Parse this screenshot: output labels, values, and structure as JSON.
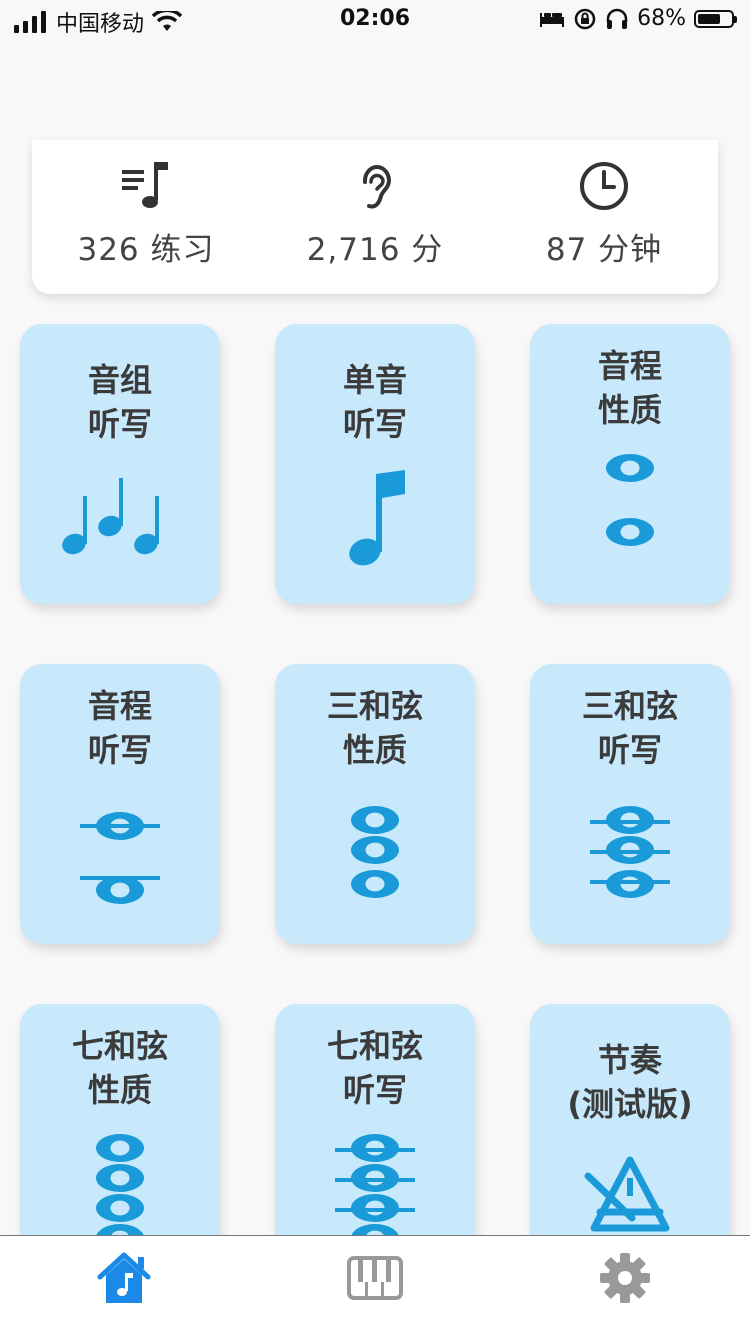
{
  "status_bar": {
    "carrier": "中国移动",
    "time": "02:06",
    "battery_percent": "68%",
    "battery_level": 0.68,
    "icons": [
      "signal-icon",
      "wifi-icon",
      "bed-icon",
      "orientation-lock-icon",
      "headphones-icon",
      "battery-icon"
    ]
  },
  "stats": [
    {
      "icon": "music-list-icon",
      "text": "326  练习"
    },
    {
      "icon": "ear-icon",
      "text": "2,716  分"
    },
    {
      "icon": "clock-icon",
      "text": "87  分钟"
    }
  ],
  "tiles": [
    {
      "title": "音组\n听写",
      "icon": "note-group-icon"
    },
    {
      "title": "单音\n听写",
      "icon": "single-note-icon"
    },
    {
      "title": "音程\n性质",
      "icon": "interval-quality-icon"
    },
    {
      "title": "音程\n听写",
      "icon": "interval-dictation-icon"
    },
    {
      "title": "三和弦\n性质",
      "icon": "triad-quality-icon"
    },
    {
      "title": "三和弦\n听写",
      "icon": "triad-dictation-icon"
    },
    {
      "title": "七和弦\n性质",
      "icon": "seventh-quality-icon"
    },
    {
      "title": "七和弦\n听写",
      "icon": "seventh-dictation-icon"
    },
    {
      "title": "节奏\n(测试版)",
      "icon": "metronome-icon"
    }
  ],
  "tabbar": {
    "tabs": [
      {
        "icon": "home-icon",
        "active": true
      },
      {
        "icon": "piano-icon",
        "active": false
      },
      {
        "icon": "gear-icon",
        "active": false
      }
    ],
    "active_color": "#1a8ae6",
    "inactive_color": "#999999"
  },
  "colors": {
    "tile_bg": "#c8e8fb",
    "icon_blue": "#1a9ad8",
    "background": "#f8f8f8"
  }
}
